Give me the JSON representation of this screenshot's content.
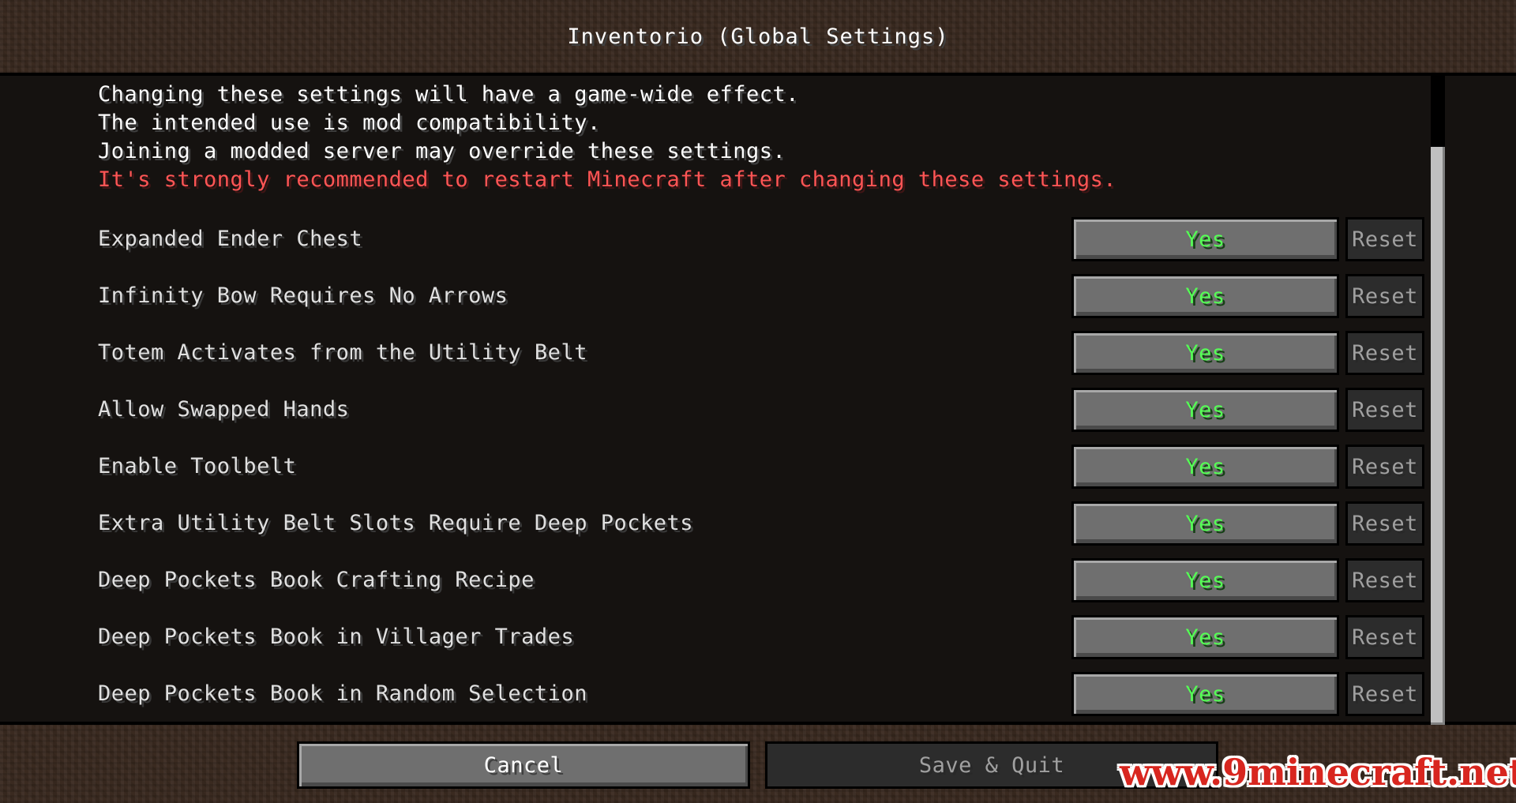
{
  "title": "Inventorio (Global Settings)",
  "info_lines": [
    "Changing these settings will have a game-wide effect.",
    "The intended use is mod compatibility.",
    "Joining a modded server may override these settings."
  ],
  "warning_line": "It's strongly recommended to restart Minecraft after changing these settings.",
  "settings": [
    {
      "label": "Expanded Ender Chest",
      "value": "Yes",
      "reset": "Reset"
    },
    {
      "label": "Infinity Bow Requires No Arrows",
      "value": "Yes",
      "reset": "Reset"
    },
    {
      "label": "Totem Activates from the Utility Belt",
      "value": "Yes",
      "reset": "Reset"
    },
    {
      "label": "Allow Swapped Hands",
      "value": "Yes",
      "reset": "Reset"
    },
    {
      "label": "Enable Toolbelt",
      "value": "Yes",
      "reset": "Reset"
    },
    {
      "label": "Extra Utility Belt Slots Require Deep Pockets",
      "value": "Yes",
      "reset": "Reset"
    },
    {
      "label": "Deep Pockets Book Crafting Recipe",
      "value": "Yes",
      "reset": "Reset"
    },
    {
      "label": "Deep Pockets Book in Villager Trades",
      "value": "Yes",
      "reset": "Reset"
    },
    {
      "label": "Deep Pockets Book in Random Selection",
      "value": "Yes",
      "reset": "Reset"
    }
  ],
  "buttons": {
    "cancel": "Cancel",
    "save": "Save & Quit"
  },
  "watermark": "www.9minecraft.net",
  "colors": {
    "value_on": "#55ff55",
    "warning": "#ff5555",
    "disabled_text": "#a0a0a0"
  }
}
